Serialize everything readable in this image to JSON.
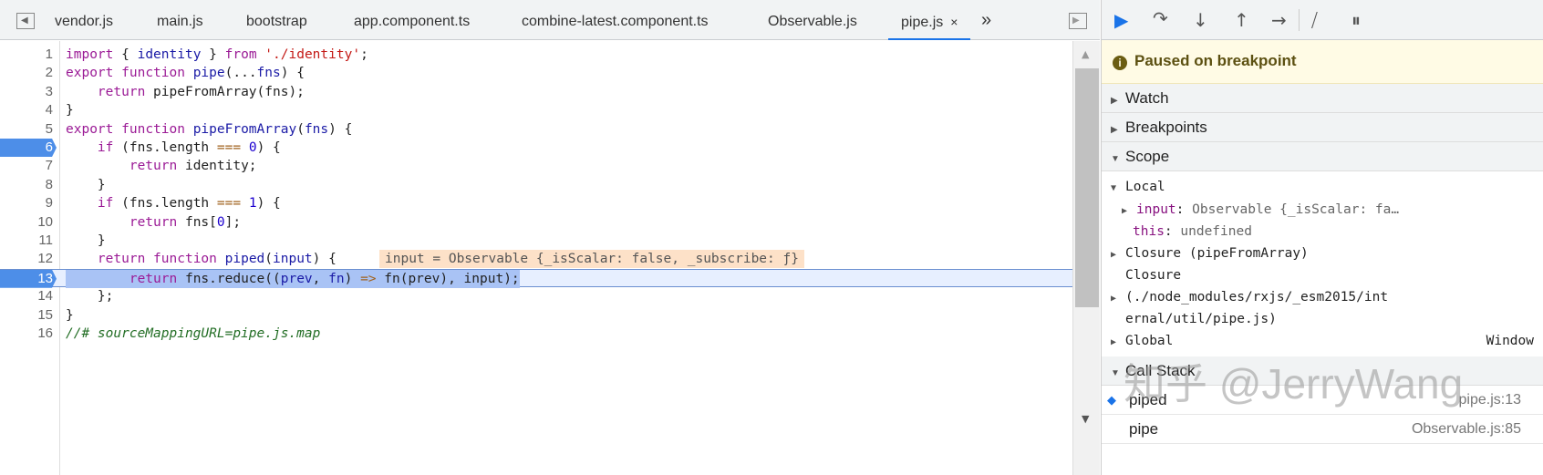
{
  "tabs": [
    {
      "label": "vendor.js"
    },
    {
      "label": "main.js"
    },
    {
      "label": "bootstrap"
    },
    {
      "label": "app.component.ts"
    },
    {
      "label": "combine-latest.component.ts"
    },
    {
      "label": "Observable.js"
    },
    {
      "label": "pipe.js",
      "active": true,
      "close": "×"
    }
  ],
  "more_tabs": "»",
  "code": [
    {
      "n": "1",
      "t": [
        [
          "kw",
          "import"
        ],
        [
          "pl",
          " { "
        ],
        [
          "df",
          "identity"
        ],
        [
          "pl",
          " } "
        ],
        [
          "kw",
          "from"
        ],
        [
          "pl",
          " "
        ],
        [
          "st",
          "'./identity'"
        ],
        [
          "pl",
          ";"
        ]
      ]
    },
    {
      "n": "2",
      "t": [
        [
          "kw",
          "export"
        ],
        [
          "pl",
          " "
        ],
        [
          "kw",
          "function"
        ],
        [
          "pl",
          " "
        ],
        [
          "df",
          "pipe"
        ],
        [
          "pl",
          "(..."
        ],
        [
          "df",
          "fns"
        ],
        [
          "pl",
          ") {"
        ]
      ]
    },
    {
      "n": "3",
      "t": [
        [
          "pl",
          "    "
        ],
        [
          "kw",
          "return"
        ],
        [
          "pl",
          " pipeFromArray(fns);"
        ]
      ]
    },
    {
      "n": "4",
      "t": [
        [
          "pl",
          "}"
        ]
      ]
    },
    {
      "n": "5",
      "t": [
        [
          "kw",
          "export"
        ],
        [
          "pl",
          " "
        ],
        [
          "kw",
          "function"
        ],
        [
          "pl",
          " "
        ],
        [
          "df",
          "pipeFromArray"
        ],
        [
          "pl",
          "("
        ],
        [
          "df",
          "fns"
        ],
        [
          "pl",
          ") {"
        ]
      ]
    },
    {
      "n": "6",
      "bp": true,
      "t": [
        [
          "pl",
          "    "
        ],
        [
          "kw",
          "if"
        ],
        [
          "pl",
          " (fns.length "
        ],
        [
          "op",
          "==="
        ],
        [
          "pl",
          " "
        ],
        [
          "nm",
          "0"
        ],
        [
          "pl",
          ") {"
        ]
      ]
    },
    {
      "n": "7",
      "t": [
        [
          "pl",
          "        "
        ],
        [
          "kw",
          "return"
        ],
        [
          "pl",
          " identity;"
        ]
      ]
    },
    {
      "n": "8",
      "t": [
        [
          "pl",
          "    }"
        ]
      ]
    },
    {
      "n": "9",
      "t": [
        [
          "pl",
          "    "
        ],
        [
          "kw",
          "if"
        ],
        [
          "pl",
          " (fns.length "
        ],
        [
          "op",
          "==="
        ],
        [
          "pl",
          " "
        ],
        [
          "nm",
          "1"
        ],
        [
          "pl",
          ") {"
        ]
      ]
    },
    {
      "n": "10",
      "t": [
        [
          "pl",
          "        "
        ],
        [
          "kw",
          "return"
        ],
        [
          "pl",
          " fns["
        ],
        [
          "nm",
          "0"
        ],
        [
          "pl",
          "];"
        ]
      ]
    },
    {
      "n": "11",
      "t": [
        [
          "pl",
          "    }"
        ]
      ]
    },
    {
      "n": "12",
      "t": [
        [
          "pl",
          "    "
        ],
        [
          "kw",
          "return"
        ],
        [
          "pl",
          " "
        ],
        [
          "kw",
          "function"
        ],
        [
          "pl",
          " "
        ],
        [
          "df",
          "piped"
        ],
        [
          "pl",
          "("
        ],
        [
          "df",
          "input"
        ],
        [
          "pl",
          ") {"
        ]
      ],
      "inline": "input = Observable {_isScalar: false, _subscribe: ƒ}"
    },
    {
      "n": "13",
      "bp": true,
      "exec": true,
      "t": [
        [
          "pl",
          "        "
        ],
        [
          "kw",
          "return"
        ],
        [
          "pl",
          " fns.reduce(("
        ],
        [
          "df",
          "prev"
        ],
        [
          "pl",
          ", "
        ],
        [
          "df",
          "fn"
        ],
        [
          "pl",
          ") "
        ],
        [
          "op",
          "=>"
        ],
        [
          "pl",
          " fn(prev), input);"
        ]
      ]
    },
    {
      "n": "14",
      "t": [
        [
          "pl",
          "    };"
        ]
      ]
    },
    {
      "n": "15",
      "t": [
        [
          "pl",
          "}"
        ]
      ]
    },
    {
      "n": "16",
      "t": [
        [
          "cm",
          "//# sourceMappingURL=pipe.js.map"
        ]
      ]
    }
  ],
  "debugger": {
    "paused": "Paused on breakpoint",
    "sections": {
      "watch": "Watch",
      "breakpoints": "Breakpoints",
      "scope": "Scope",
      "call_stack": "Call Stack"
    },
    "scope": {
      "local": "Local",
      "input_name": "input",
      "input_value": "Observable {_isScalar: fa…",
      "this_name": "this",
      "this_value": "undefined",
      "closure1": "Closure (pipeFromArray)",
      "closure2_a": "Closure",
      "closure2_b": "(./node_modules/rxjs/_esm2015/int",
      "closure2_c": "ernal/util/pipe.js)",
      "global": "Global",
      "global_value": "Window"
    },
    "call_stack": [
      {
        "name": "piped",
        "loc": "pipe.js:13",
        "current": true
      },
      {
        "name": "pipe",
        "loc": "Observable.js:85"
      }
    ]
  },
  "watermark": "知乎 @JerryWang"
}
